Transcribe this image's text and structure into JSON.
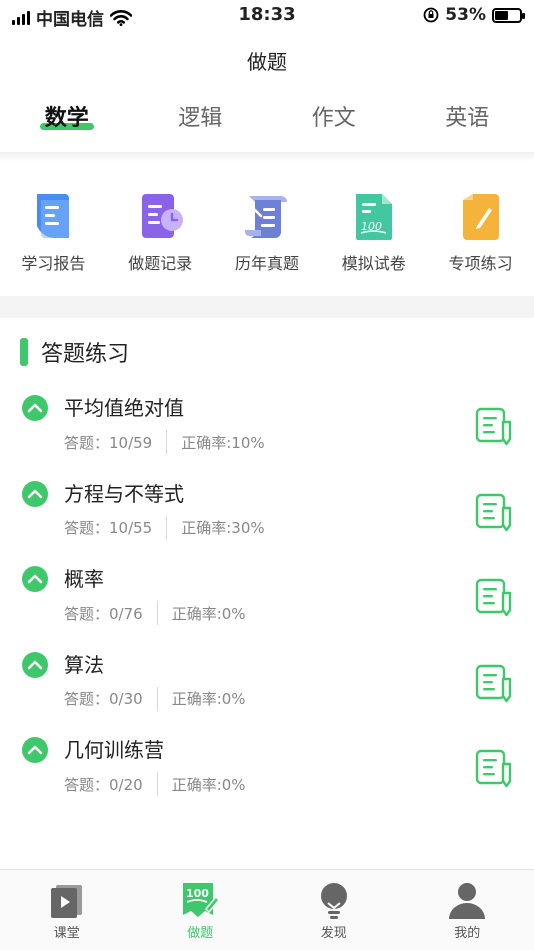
{
  "status_bar": {
    "carrier": "中国电信",
    "time": "18:33",
    "battery": "53%",
    "battery_level": 0.53
  },
  "nav": {
    "title": "做题"
  },
  "tabs": [
    {
      "label": "数学",
      "active": true
    },
    {
      "label": "逻辑",
      "active": false
    },
    {
      "label": "作文",
      "active": false
    },
    {
      "label": "英语",
      "active": false
    }
  ],
  "tools": [
    {
      "label": "学习报告",
      "icon": "report-icon"
    },
    {
      "label": "做题记录",
      "icon": "record-icon"
    },
    {
      "label": "历年真题",
      "icon": "past-exams-icon"
    },
    {
      "label": "模拟试卷",
      "icon": "mock-exam-icon"
    },
    {
      "label": "专项练习",
      "icon": "special-practice-icon"
    }
  ],
  "section": {
    "title": "答题练习"
  },
  "practice": [
    {
      "title": "平均值绝对值",
      "answered": "答题：10/59",
      "accuracy": "正确率:10%"
    },
    {
      "title": "方程与不等式",
      "answered": "答题：10/55",
      "accuracy": "正确率:30%"
    },
    {
      "title": "概率",
      "answered": "答题：0/76",
      "accuracy": "正确率:0%"
    },
    {
      "title": "算法",
      "answered": "答题：0/30",
      "accuracy": "正确率:0%"
    },
    {
      "title": "几何训练营",
      "answered": "答题：0/20",
      "accuracy": "正确率:0%"
    }
  ],
  "bottom_tabs": [
    {
      "label": "课堂",
      "icon": "classroom-icon",
      "active": false
    },
    {
      "label": "做题",
      "icon": "practice-icon",
      "badge": "100",
      "active": true
    },
    {
      "label": "发现",
      "icon": "discover-icon",
      "active": false
    },
    {
      "label": "我的",
      "icon": "profile-icon",
      "active": false
    }
  ],
  "colors": {
    "accent": "#3ec86b",
    "report": "#4a8df0",
    "record": "#8a63e8",
    "past": "#6e7fd6",
    "mock": "#44c6a0",
    "special": "#f4b43c"
  }
}
